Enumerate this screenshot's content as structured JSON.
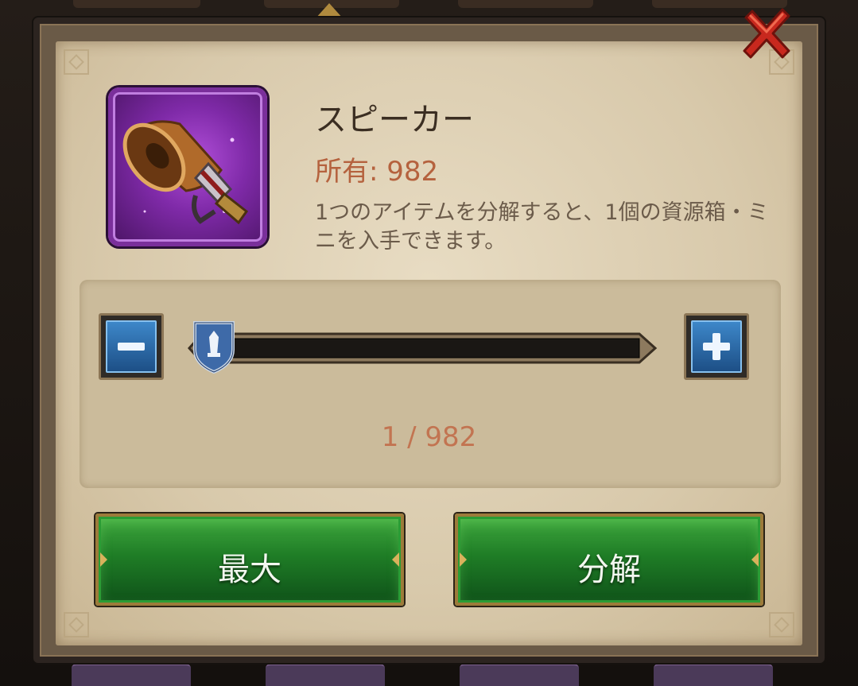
{
  "item": {
    "name": "スピーカー",
    "owned_label": "所有: 982",
    "description": "1つのアイテムを分解すると、1個の資源箱・ミニを入手できます。",
    "icon": "megaphone-icon",
    "rarity_color": "#8a2fb3"
  },
  "slider": {
    "current": 1,
    "max": 982,
    "count_label": "1 / 982",
    "level": 0.001
  },
  "buttons": {
    "max_label": "最大",
    "dismantle_label": "分解"
  },
  "colors": {
    "accent_orange": "#b5623e",
    "button_green": "#1f7d26",
    "stepper_blue": "#2b6aa8",
    "close_red": "#c8281e"
  }
}
